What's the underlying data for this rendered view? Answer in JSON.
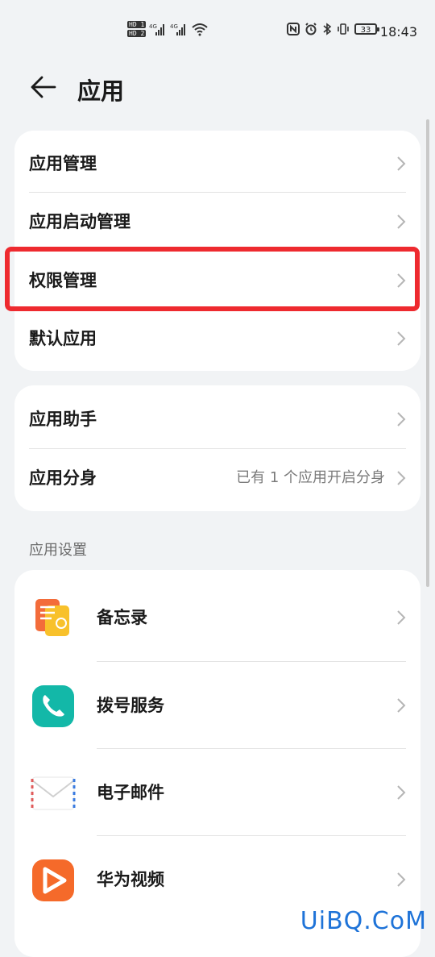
{
  "status_bar": {
    "time": "18:43",
    "battery": "33",
    "sim1": "HD 1",
    "sim2": "HD 2",
    "net1": "4G",
    "net2": "4G"
  },
  "header": {
    "title": "应用"
  },
  "card1": [
    {
      "label": "应用管理"
    },
    {
      "label": "应用启动管理"
    },
    {
      "label": "权限管理"
    },
    {
      "label": "默认应用"
    }
  ],
  "card2": [
    {
      "label": "应用助手",
      "value": ""
    },
    {
      "label": "应用分身",
      "value": "已有 1 个应用开启分身"
    }
  ],
  "section": {
    "title": "应用设置"
  },
  "apps": [
    {
      "label": "备忘录",
      "icon": "notepad-icon"
    },
    {
      "label": "拨号服务",
      "icon": "phone-icon"
    },
    {
      "label": "电子邮件",
      "icon": "email-icon"
    },
    {
      "label": "华为视频",
      "icon": "video-icon"
    }
  ],
  "watermark": "UiBQ.CoM",
  "colors": {
    "highlight": "#ee2a2f",
    "background": "#f1f3f5",
    "card": "#ffffff"
  }
}
